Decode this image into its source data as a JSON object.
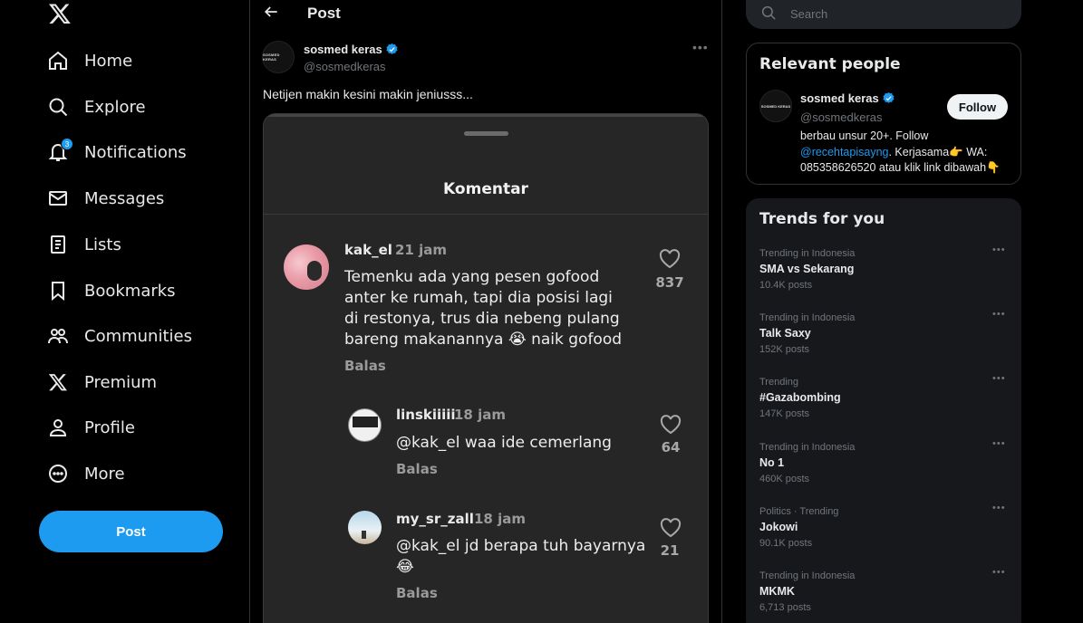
{
  "nav": {
    "items": [
      {
        "label": "Home",
        "icon": "home-icon"
      },
      {
        "label": "Explore",
        "icon": "search-icon"
      },
      {
        "label": "Notifications",
        "icon": "bell-icon",
        "badge": "3"
      },
      {
        "label": "Messages",
        "icon": "envelope-icon"
      },
      {
        "label": "Lists",
        "icon": "list-icon"
      },
      {
        "label": "Bookmarks",
        "icon": "bookmark-icon"
      },
      {
        "label": "Communities",
        "icon": "people-icon"
      },
      {
        "label": "Premium",
        "icon": "x-logo-icon"
      },
      {
        "label": "Profile",
        "icon": "person-icon"
      },
      {
        "label": "More",
        "icon": "more-circle-icon"
      }
    ],
    "post_button": "Post"
  },
  "post": {
    "header_title": "Post",
    "author_name": "sosmed keras",
    "author_handle": "@sosmedkeras",
    "avatar_text": "SOSMED KERAS",
    "text": "Netijen makin kesini makin jeniusss...",
    "media": {
      "title": "Komentar",
      "comments": [
        {
          "user": "kak_el",
          "time": "21 jam",
          "lines": [
            "Temenku ada yang pesen gofood",
            "anter ke rumah, tapi dia posisi lagi",
            "di restonya, trus dia nebeng pulang",
            "bareng makanannya 😭 naik gofood"
          ],
          "reply": "Balas",
          "likes": "837"
        },
        {
          "user": "linskiiiii",
          "time": "18 jam",
          "lines": [
            "@kak_el waa ide cemerlang"
          ],
          "reply": "Balas",
          "likes": "64"
        },
        {
          "user": "my_sr_zall",
          "time": "18 jam",
          "lines": [
            "@kak_el jd berapa tuh bayarnya",
            "😂"
          ],
          "reply": "Balas",
          "likes": "21"
        }
      ]
    }
  },
  "search": {
    "placeholder": "Search"
  },
  "relevant": {
    "title": "Relevant people",
    "name": "sosmed keras",
    "handle": "@sosmedkeras",
    "follow": "Follow",
    "bio_before": "berbau unsur 20+. Follow ",
    "bio_mention": "@recehtapisayng",
    "bio_after": ". Kerjasama👉 WA: 085358626520 atau klik link dibawah👇"
  },
  "trends": {
    "title": "Trends for you",
    "items": [
      {
        "context": "Trending in Indonesia",
        "name": "SMA vs Sekarang",
        "count": "10.4K posts"
      },
      {
        "context": "Trending in Indonesia",
        "name": "Talk Saxy",
        "count": "152K posts"
      },
      {
        "context": "Trending",
        "name": "#Gazabombing",
        "count": "147K posts"
      },
      {
        "context": "Trending in Indonesia",
        "name": "No 1",
        "count": "460K posts"
      },
      {
        "context": "Politics · Trending",
        "name": "Jokowi",
        "count": "90.1K posts"
      },
      {
        "context": "Trending in Indonesia",
        "name": "MKMK",
        "count": "6,713 posts"
      }
    ]
  },
  "colors": {
    "accent": "#1d9bf0",
    "background": "#000000",
    "panel": "#16181c",
    "media_bg": "#262626"
  }
}
